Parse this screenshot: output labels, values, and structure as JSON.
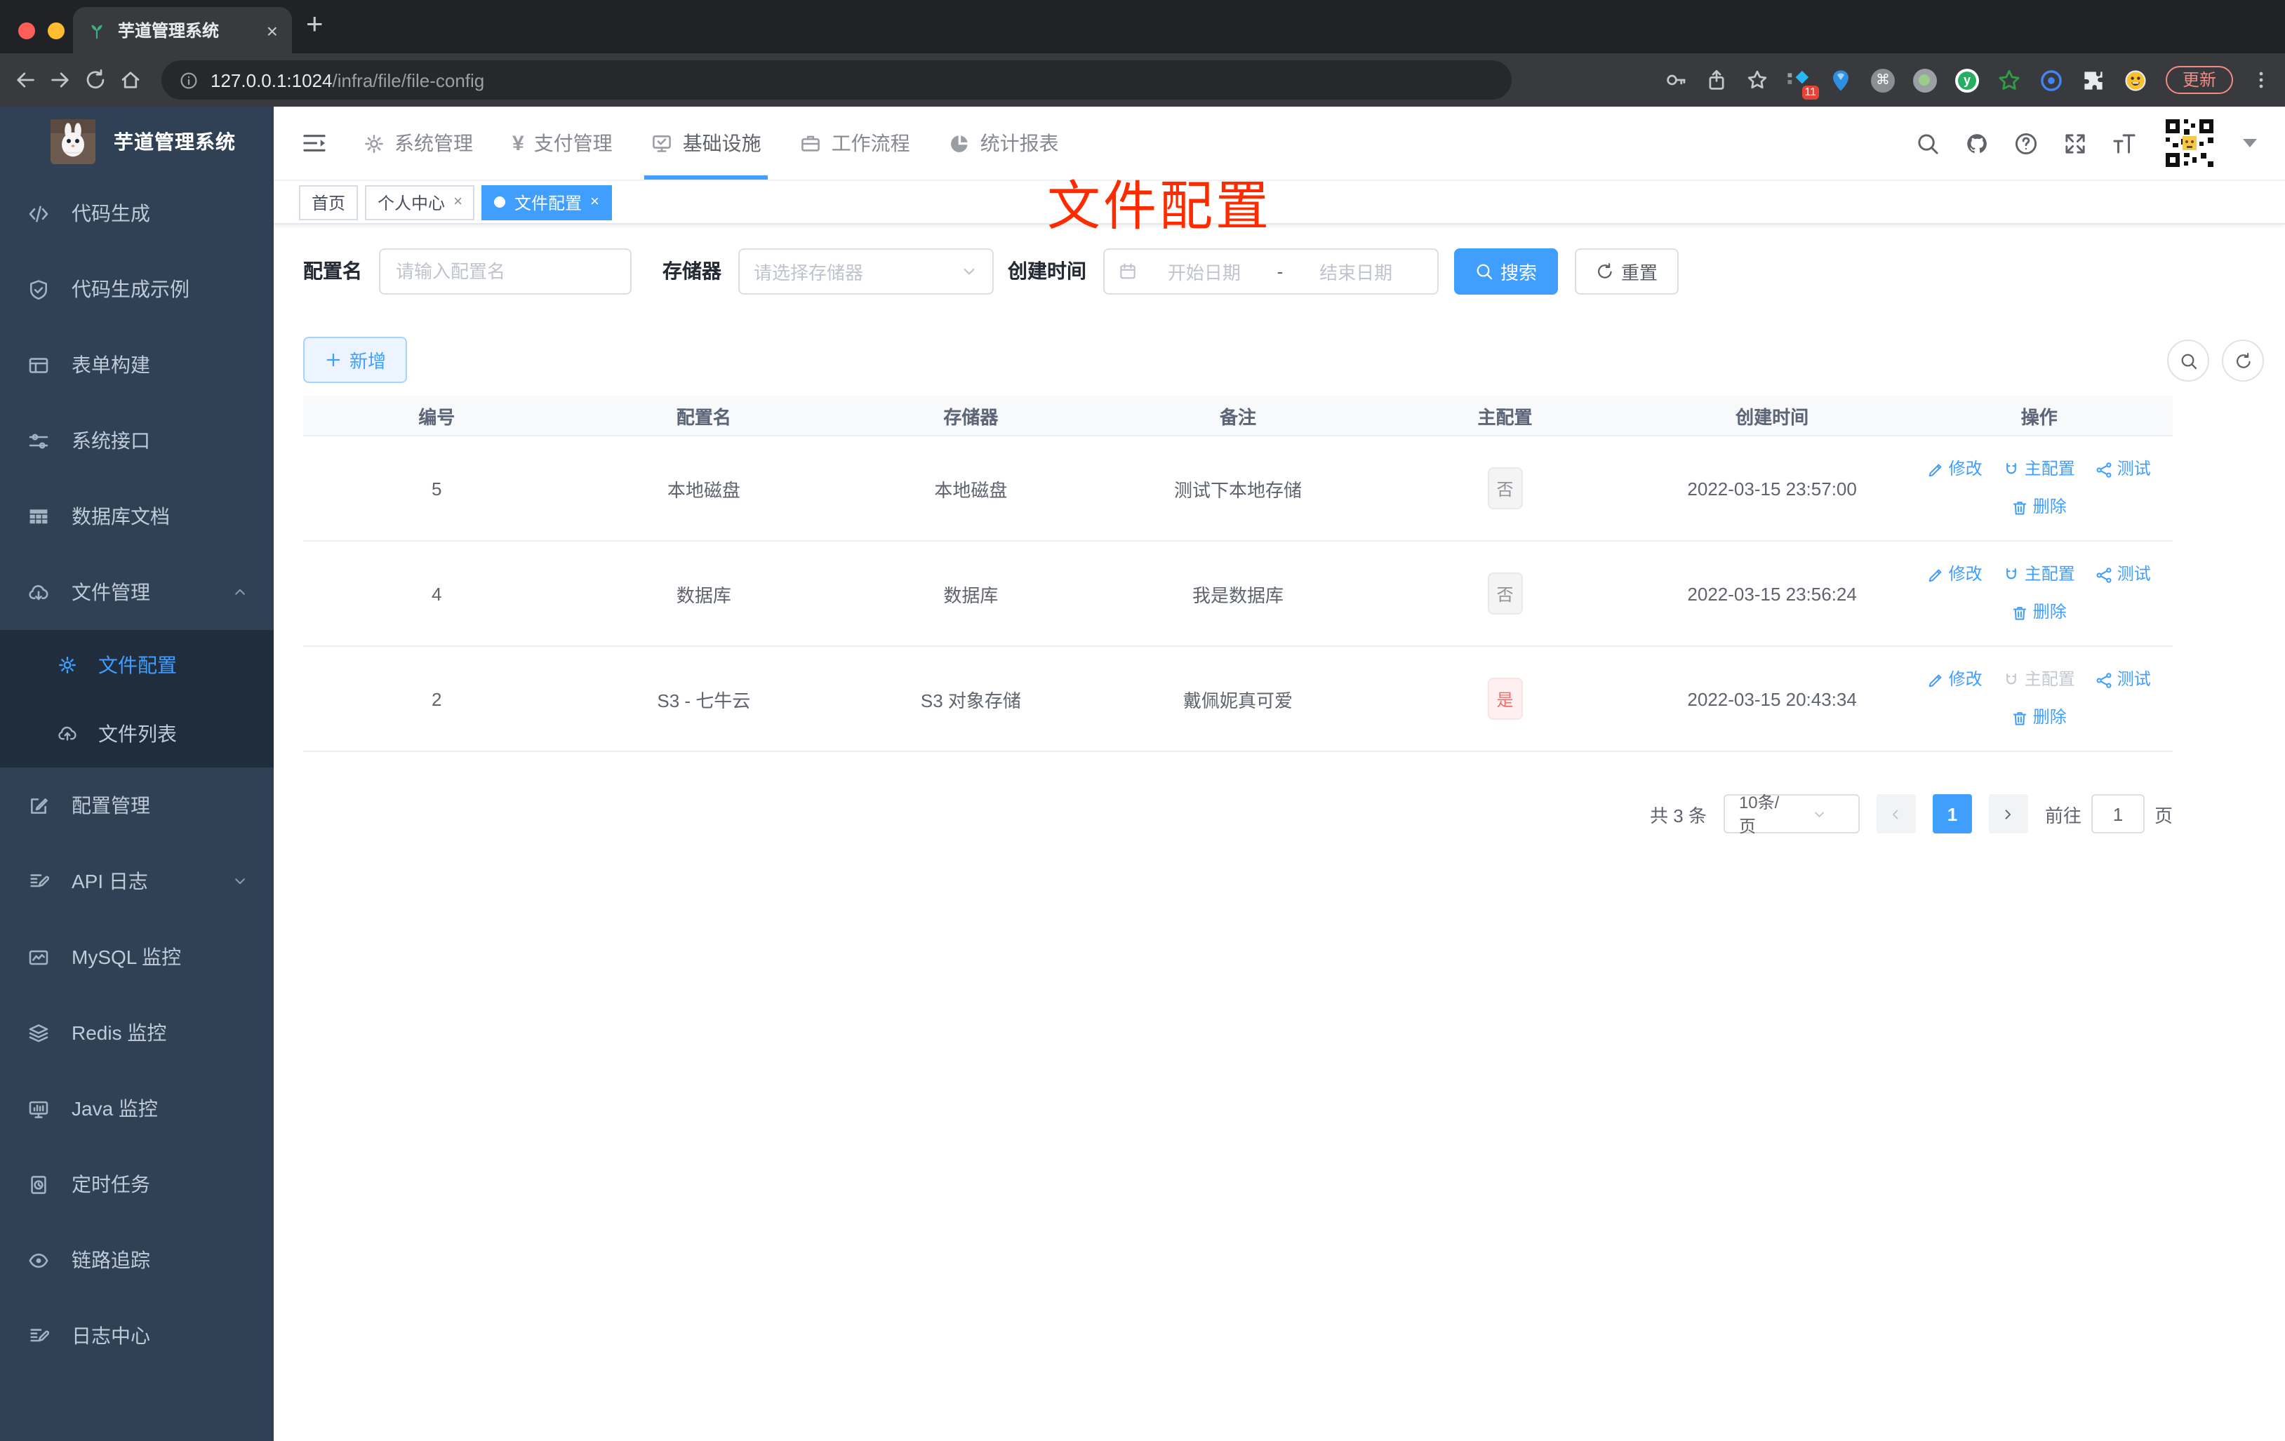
{
  "colors": {
    "accent": "#409eff",
    "danger": "#f56c6c",
    "sidebar_bg": "#304156",
    "submenu_bg": "#1f2d3d",
    "annotation": "#ff2b00"
  },
  "browser": {
    "tab_title": "芋道管理系统",
    "close_glyph": "×",
    "new_tab_glyph": "+",
    "url_host": "127.0.0.1:1024",
    "url_path": "/infra/file/file-config",
    "extension_badge": "11",
    "update_label": "更新"
  },
  "sidebar": {
    "title": "芋道管理系统",
    "items": [
      {
        "label": "代码生成",
        "icon": "code-icon"
      },
      {
        "label": "代码生成示例",
        "icon": "shield-check-icon"
      },
      {
        "label": "表单构建",
        "icon": "form-icon"
      },
      {
        "label": "系统接口",
        "icon": "sliders-icon"
      },
      {
        "label": "数据库文档",
        "icon": "grid-icon"
      },
      {
        "label": "文件管理",
        "icon": "cloud-download-icon",
        "chevron": "up",
        "children": [
          {
            "label": "文件配置",
            "icon": "gear-icon",
            "active": true
          },
          {
            "label": "文件列表",
            "icon": "cloud-upload-icon"
          }
        ]
      },
      {
        "label": "配置管理",
        "icon": "edit-square-icon"
      },
      {
        "label": "API 日志",
        "icon": "doc-edit-icon",
        "chevron": "down"
      },
      {
        "label": "MySQL 监控",
        "icon": "chart-icon"
      },
      {
        "label": "Redis 监控",
        "icon": "layers-icon"
      },
      {
        "label": "Java 监控",
        "icon": "monitor-icon"
      },
      {
        "label": "定时任务",
        "icon": "schedule-icon"
      },
      {
        "label": "链路追踪",
        "icon": "eye-icon"
      },
      {
        "label": "日志中心",
        "icon": "doc-edit-icon"
      }
    ]
  },
  "topnav": {
    "items": [
      {
        "label": "系统管理",
        "icon": "gear-icon"
      },
      {
        "label": "支付管理",
        "icon": "yen-icon"
      },
      {
        "label": "基础设施",
        "icon": "infra-icon",
        "active": true
      },
      {
        "label": "工作流程",
        "icon": "briefcase-icon"
      },
      {
        "label": "统计报表",
        "icon": "pie-icon"
      }
    ]
  },
  "tags_view": {
    "tags": [
      {
        "label": "首页"
      },
      {
        "label": "个人中心",
        "closable": true
      },
      {
        "label": "文件配置",
        "closable": true,
        "active": true
      }
    ],
    "close_glyph": "×"
  },
  "annotation": {
    "text": "文件配置"
  },
  "filters": {
    "name_label": "配置名",
    "name_placeholder": "请输入配置名",
    "storage_label": "存储器",
    "storage_placeholder": "请选择存储器",
    "date_label": "创建时间",
    "date_start_placeholder": "开始日期",
    "date_separator": "-",
    "date_end_placeholder": "结束日期",
    "search_label": "搜索",
    "reset_label": "重置"
  },
  "toolbar": {
    "add_label": "新增"
  },
  "table": {
    "columns": [
      "编号",
      "配置名",
      "存储器",
      "备注",
      "主配置",
      "创建时间",
      "操作"
    ],
    "action_labels": {
      "edit": "修改",
      "master": "主配置",
      "test": "测试",
      "delete": "删除"
    },
    "rows": [
      {
        "id": "5",
        "name": "本地磁盘",
        "storage": "本地磁盘",
        "remark": "测试下本地存储",
        "master": "否",
        "master_type": "info",
        "created": "2022-03-15 23:57:00",
        "master_disabled": false
      },
      {
        "id": "4",
        "name": "数据库",
        "storage": "数据库",
        "remark": "我是数据库",
        "master": "否",
        "master_type": "info",
        "created": "2022-03-15 23:56:24",
        "master_disabled": false
      },
      {
        "id": "2",
        "name": "S3 - 七牛云",
        "storage": "S3 对象存储",
        "remark": "戴佩妮真可爱",
        "master": "是",
        "master_type": "danger",
        "created": "2022-03-15 20:43:34",
        "master_disabled": true
      }
    ]
  },
  "pagination": {
    "total": "共 3 条",
    "page_size": "10条/页",
    "current_page": "1",
    "goto_label": "前往",
    "goto_value": "1",
    "page_unit": "页"
  }
}
